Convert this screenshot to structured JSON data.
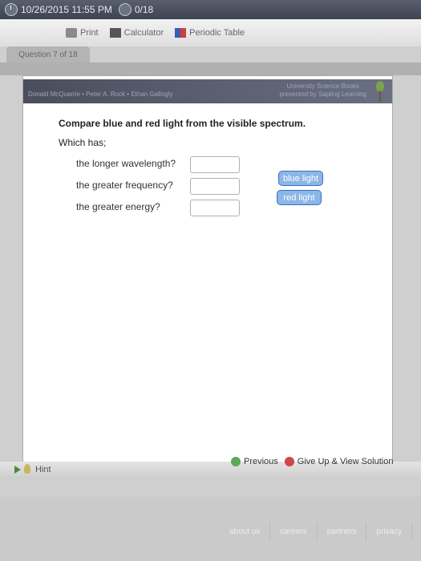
{
  "topbar": {
    "datetime": "10/26/2015 11:55 PM",
    "score": "0/18"
  },
  "toolbar": {
    "print": "Print",
    "calculator": "Calculator",
    "periodic_table": "Periodic Table"
  },
  "question_tab": "Question 7 of 18",
  "banner": {
    "authors": "Donald McQuarrie • Peter A. Rock • Ethan Gallogly",
    "publisher_line1": "University Science Books",
    "publisher_line2": "presented by Sapling Learning"
  },
  "content": {
    "prompt": "Compare blue and red light from the visible spectrum.",
    "which": "Which has;",
    "questions": [
      "the longer wavelength?",
      "the greater frequency?",
      "the greater energy?"
    ],
    "choices": [
      "blue light",
      "red light"
    ]
  },
  "nav": {
    "previous": "Previous",
    "give_up": "Give Up & View Solution"
  },
  "hint": "Hint",
  "footer": {
    "links": [
      "about us",
      "careers",
      "partners",
      "privacy"
    ]
  }
}
